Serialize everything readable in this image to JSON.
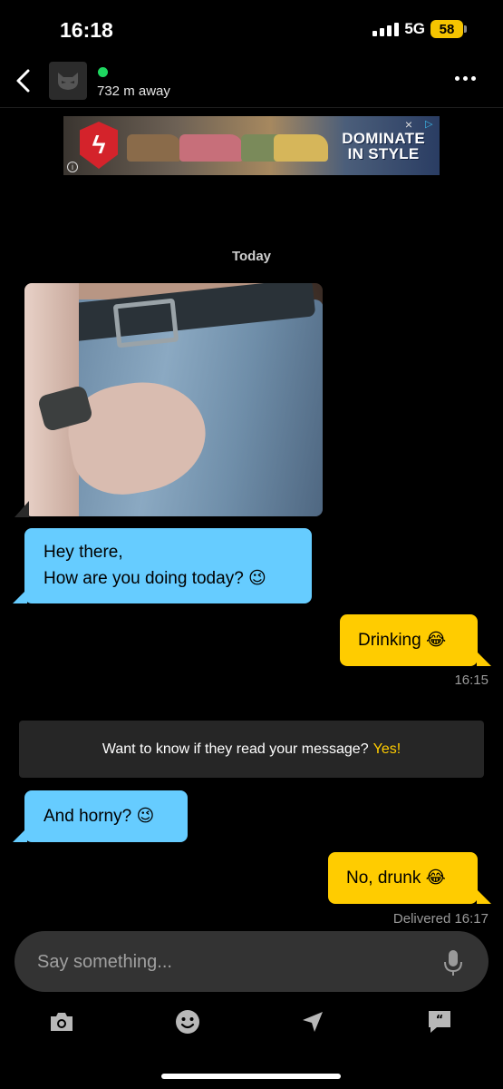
{
  "status_bar": {
    "time": "16:18",
    "network": "5G",
    "battery": "58",
    "battery_color": "#f5c400"
  },
  "header": {
    "back_icon": "chevron-left-icon",
    "avatar_icon": "grindr-mask-icon",
    "online": true,
    "online_color": "#1ed760",
    "distance": "732 m away",
    "more_icon": "more-horizontal-icon"
  },
  "ad": {
    "logo_glyph": "ϟ",
    "headline_line1": "DOMINATE",
    "headline_line2": "IN STYLE",
    "close_glyph": "×",
    "choices_glyph": "▷",
    "info_glyph": "i"
  },
  "conversation": {
    "date_label": "Today",
    "messages": [
      {
        "direction": "incoming",
        "type": "image",
        "alt": "photo-message"
      },
      {
        "direction": "incoming",
        "type": "text",
        "line1": "Hey there,",
        "line2": "How are you doing today?",
        "emoji": "😉"
      },
      {
        "direction": "outgoing",
        "type": "text",
        "text": "Drinking",
        "emoji": "😂",
        "time": "16:15"
      },
      {
        "direction": "incoming",
        "type": "text",
        "text": "And horny?",
        "emoji": "😉"
      },
      {
        "direction": "outgoing",
        "type": "text",
        "text": "No, drunk",
        "emoji": "😂",
        "status": "Delivered 16:17"
      }
    ],
    "read_receipt_prompt": {
      "text": "Want to know if they read your message?",
      "cta": "Yes!"
    }
  },
  "composer": {
    "placeholder": "Say something...",
    "mic_icon": "microphone-icon"
  },
  "toolbar": {
    "items": [
      {
        "icon": "camera-icon"
      },
      {
        "icon": "smiley-icon"
      },
      {
        "icon": "location-arrow-icon"
      },
      {
        "icon": "saved-phrases-icon"
      }
    ]
  },
  "colors": {
    "incoming_bubble": "#66ccff",
    "outgoing_bubble": "#ffcc00",
    "background": "#000000",
    "accent": "#ffcc00"
  }
}
